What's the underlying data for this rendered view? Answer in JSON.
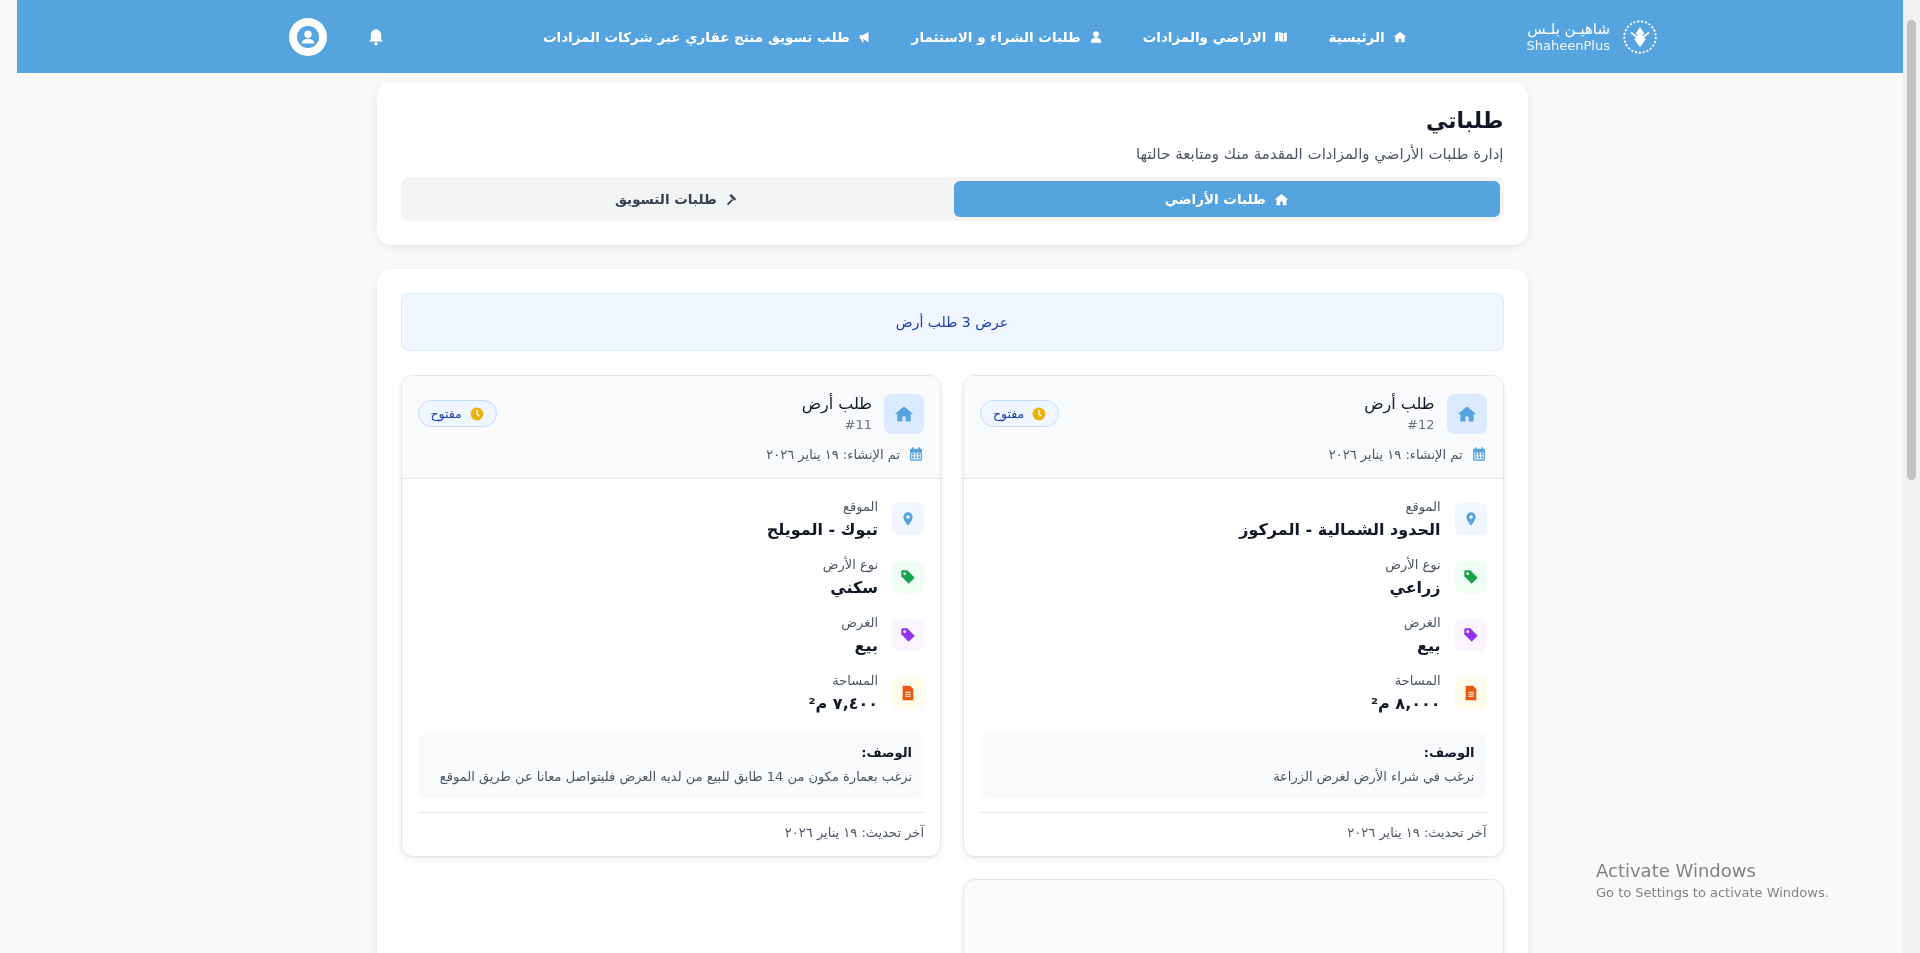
{
  "navbar": {
    "logo": {
      "arabic": "شاهيـن بلـس",
      "latin": "ShaheenPlus"
    },
    "links": [
      {
        "label": "الرئيسية"
      },
      {
        "label": "الاراضي والمزادات"
      },
      {
        "label": "طلبات الشراء و الاستثمار"
      },
      {
        "label": "طلب تسويق منتج عقاري عبر شركات المزادات"
      }
    ]
  },
  "page_header": {
    "title": "طلباتي",
    "subtitle": "إدارة طلبات الأراضي والمزادات المقدمة منك ومتابعة حالتها",
    "tabs": [
      {
        "label": "طلبات الأراضي",
        "selected": true
      },
      {
        "label": "طلبات التسويق",
        "selected": false
      }
    ]
  },
  "results_banner": "عرض 3 طلب أرض",
  "requests": [
    {
      "title": "طلب أرض",
      "number": "#12",
      "status": "مفتوح",
      "created": "تم الإنشاء: ١٩ يناير ٢٠٢٦",
      "fields": [
        {
          "kind": "location",
          "label": "الموقع",
          "value": "الحدود الشمالية - المركوز"
        },
        {
          "kind": "type",
          "label": "نوع الأرض",
          "value": "زراعي"
        },
        {
          "kind": "purpose",
          "label": "الغرض",
          "value": "بيع"
        },
        {
          "kind": "area",
          "label": "المساحة",
          "value": "٨,٠٠٠ م²"
        }
      ],
      "description_label": "الوصف:",
      "description": "نرغب في شراء الأرض لغرض الزراعة",
      "updated": "آخر تحديث: ١٩ يناير ٢٠٢٦"
    },
    {
      "title": "طلب أرض",
      "number": "#11",
      "status": "مفتوح",
      "created": "تم الإنشاء: ١٩ يناير ٢٠٢٦",
      "fields": [
        {
          "kind": "location",
          "label": "الموقع",
          "value": "تبوك - المويلح"
        },
        {
          "kind": "type",
          "label": "نوع الأرض",
          "value": "سكني"
        },
        {
          "kind": "purpose",
          "label": "الغرض",
          "value": "بيع"
        },
        {
          "kind": "area",
          "label": "المساحة",
          "value": "٧,٤٠٠ م²"
        }
      ],
      "description_label": "الوصف:",
      "description": "نرغب بعمارة مكون من 14 طابق للبيع من لديه العرض فليتواصل معانا عن طريق الموقع",
      "updated": "آخر تحديث: ١٩ يناير ٢٠٢٦"
    }
  ],
  "os_notice": {
    "title": "Activate Windows",
    "subtitle": "Go to Settings to activate Windows."
  }
}
